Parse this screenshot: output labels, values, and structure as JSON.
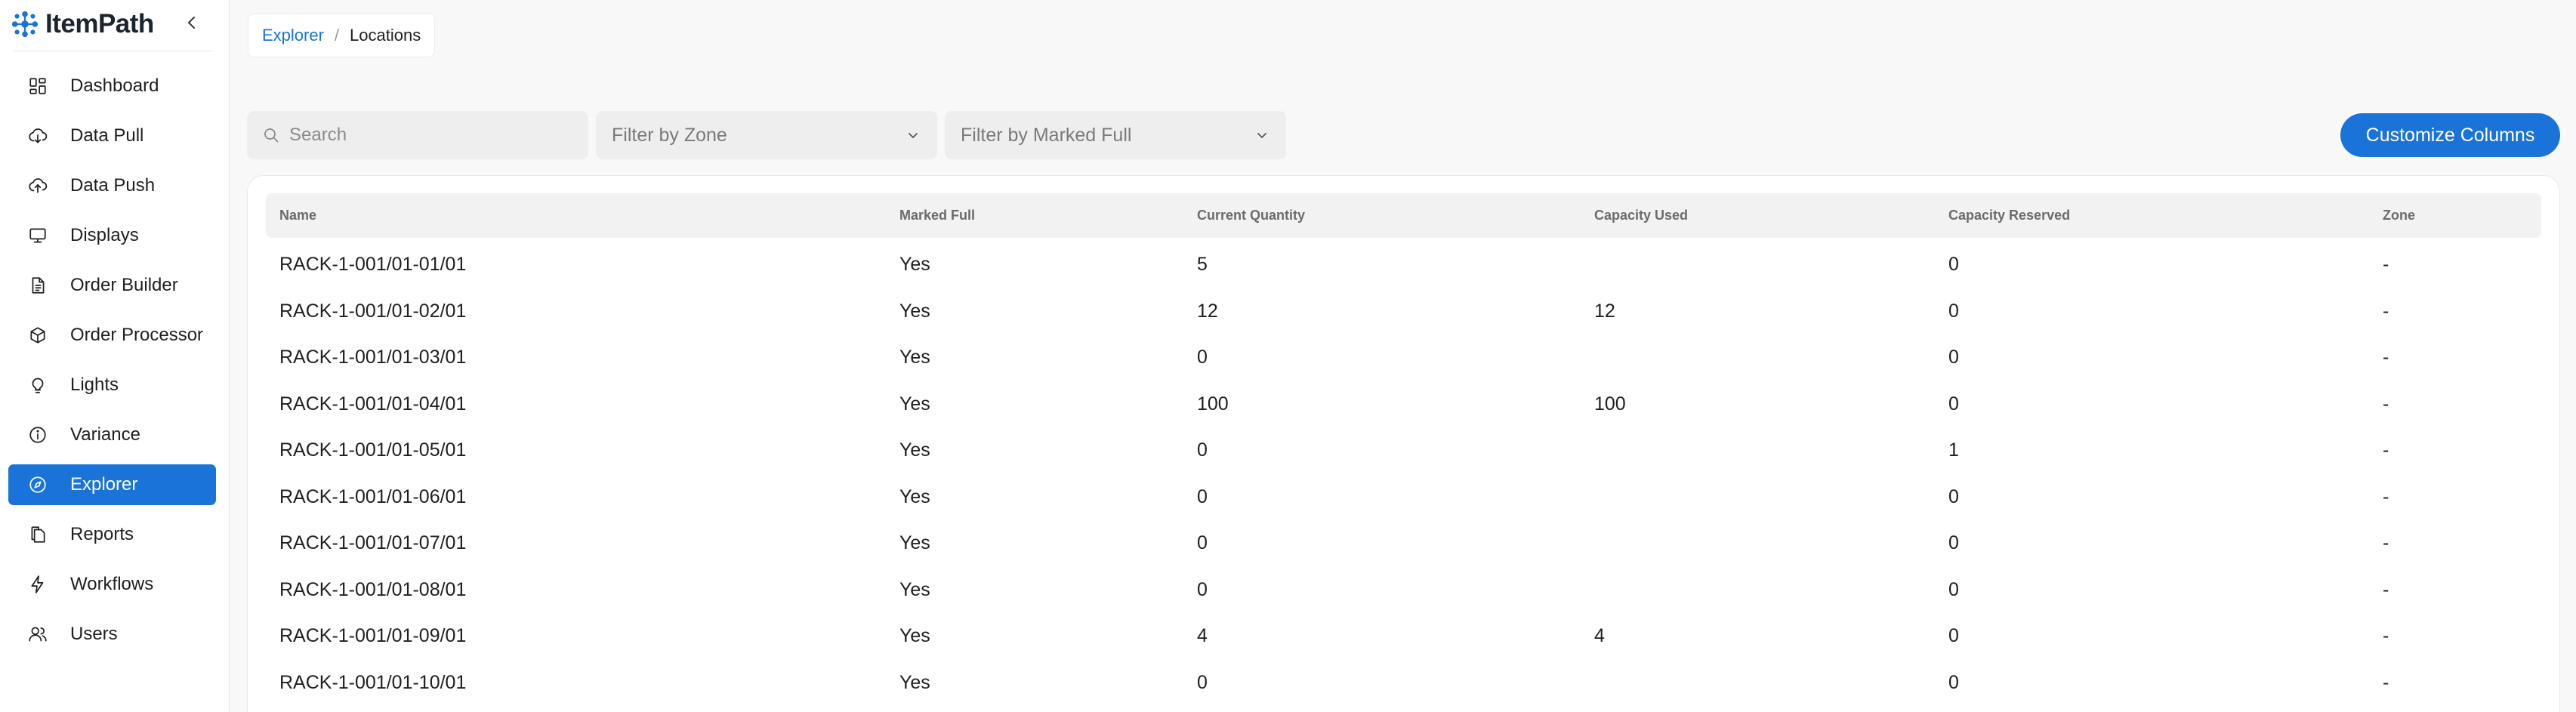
{
  "brand": {
    "name": "ItemPath"
  },
  "sidebar": {
    "items": [
      {
        "label": "Dashboard",
        "icon": "dashboard-icon"
      },
      {
        "label": "Data Pull",
        "icon": "cloud-download-icon"
      },
      {
        "label": "Data Push",
        "icon": "cloud-upload-icon"
      },
      {
        "label": "Displays",
        "icon": "monitor-icon"
      },
      {
        "label": "Order Builder",
        "icon": "document-icon"
      },
      {
        "label": "Order Processor",
        "icon": "package-icon"
      },
      {
        "label": "Lights",
        "icon": "lightbulb-icon"
      },
      {
        "label": "Variance",
        "icon": "info-icon"
      },
      {
        "label": "Explorer",
        "icon": "compass-icon",
        "active": true
      },
      {
        "label": "Reports",
        "icon": "files-icon"
      },
      {
        "label": "Workflows",
        "icon": "lightning-icon"
      },
      {
        "label": "Users",
        "icon": "users-icon"
      }
    ]
  },
  "breadcrumb": {
    "parent": "Explorer",
    "separator": "/",
    "current": "Locations"
  },
  "toolbar": {
    "search_placeholder": "Search",
    "zone_filter_placeholder": "Filter by Zone",
    "marked_full_filter_placeholder": "Filter by Marked Full",
    "customize_label": "Customize Columns"
  },
  "table": {
    "columns": {
      "name": "Name",
      "marked_full": "Marked Full",
      "current_quantity": "Current Quantity",
      "capacity_used": "Capacity Used",
      "capacity_reserved": "Capacity Reserved",
      "zone": "Zone"
    },
    "rows": [
      {
        "name": "RACK-1-001/01-01/01",
        "marked_full": "Yes",
        "current_quantity": "5",
        "capacity_used": "",
        "capacity_reserved": "0",
        "zone": "-"
      },
      {
        "name": "RACK-1-001/01-02/01",
        "marked_full": "Yes",
        "current_quantity": "12",
        "capacity_used": "12",
        "capacity_reserved": "0",
        "zone": "-"
      },
      {
        "name": "RACK-1-001/01-03/01",
        "marked_full": "Yes",
        "current_quantity": "0",
        "capacity_used": "",
        "capacity_reserved": "0",
        "zone": "-"
      },
      {
        "name": "RACK-1-001/01-04/01",
        "marked_full": "Yes",
        "current_quantity": "100",
        "capacity_used": "100",
        "capacity_reserved": "0",
        "zone": "-"
      },
      {
        "name": "RACK-1-001/01-05/01",
        "marked_full": "Yes",
        "current_quantity": "0",
        "capacity_used": "",
        "capacity_reserved": "1",
        "zone": "-"
      },
      {
        "name": "RACK-1-001/01-06/01",
        "marked_full": "Yes",
        "current_quantity": "0",
        "capacity_used": "",
        "capacity_reserved": "0",
        "zone": "-"
      },
      {
        "name": "RACK-1-001/01-07/01",
        "marked_full": "Yes",
        "current_quantity": "0",
        "capacity_used": "",
        "capacity_reserved": "0",
        "zone": "-"
      },
      {
        "name": "RACK-1-001/01-08/01",
        "marked_full": "Yes",
        "current_quantity": "0",
        "capacity_used": "",
        "capacity_reserved": "0",
        "zone": "-"
      },
      {
        "name": "RACK-1-001/01-09/01",
        "marked_full": "Yes",
        "current_quantity": "4",
        "capacity_used": "4",
        "capacity_reserved": "0",
        "zone": "-"
      },
      {
        "name": "RACK-1-001/01-10/01",
        "marked_full": "Yes",
        "current_quantity": "0",
        "capacity_used": "",
        "capacity_reserved": "0",
        "zone": "-"
      }
    ]
  },
  "colors": {
    "accent": "#1a73d9",
    "logo": "#1a73d9",
    "surface": "#ffffff",
    "background": "#f8f8f8"
  }
}
